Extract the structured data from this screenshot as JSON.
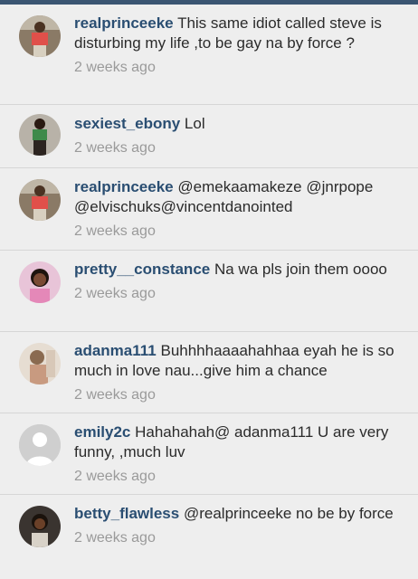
{
  "comments": [
    {
      "username": "realprinceeke",
      "text": "This same idiot called steve is disturbing my life ,to be gay na by force ?",
      "time": "2 weeks ago",
      "avatar": "user-photo-red-shirt"
    },
    {
      "username": "sexiest_ebony",
      "text": "Lol",
      "time": "2 weeks ago",
      "avatar": "user-photo-green-top"
    },
    {
      "username": "realprinceeke",
      "text": "@emekaamakeze @jnrpope @elvischuks@vincentdanointed",
      "time": "2 weeks ago",
      "avatar": "user-photo-red-shirt"
    },
    {
      "username": "pretty__constance",
      "text": "Na wa pls join them oooo",
      "time": "2 weeks ago",
      "avatar": "user-photo-pink"
    },
    {
      "username": "adanma111",
      "text": "Buhhhhaaaahahhaa eyah he is so much in love nau...give him a chance",
      "time": "2 weeks ago",
      "avatar": "user-photo-faded"
    },
    {
      "username": "emily2c",
      "text": "Hahahahah@ adanma111 U are very funny, ,much luv",
      "time": "2 weeks ago",
      "avatar": "default-avatar"
    },
    {
      "username": "betty_flawless",
      "text": "@realprinceeke no be by force",
      "time": "2 weeks ago",
      "avatar": "user-photo-dark"
    }
  ],
  "colors": {
    "username": "#2a4e72",
    "timestamp": "#9a9a9a",
    "background": "#eeeeee",
    "header": "#3b5572"
  }
}
